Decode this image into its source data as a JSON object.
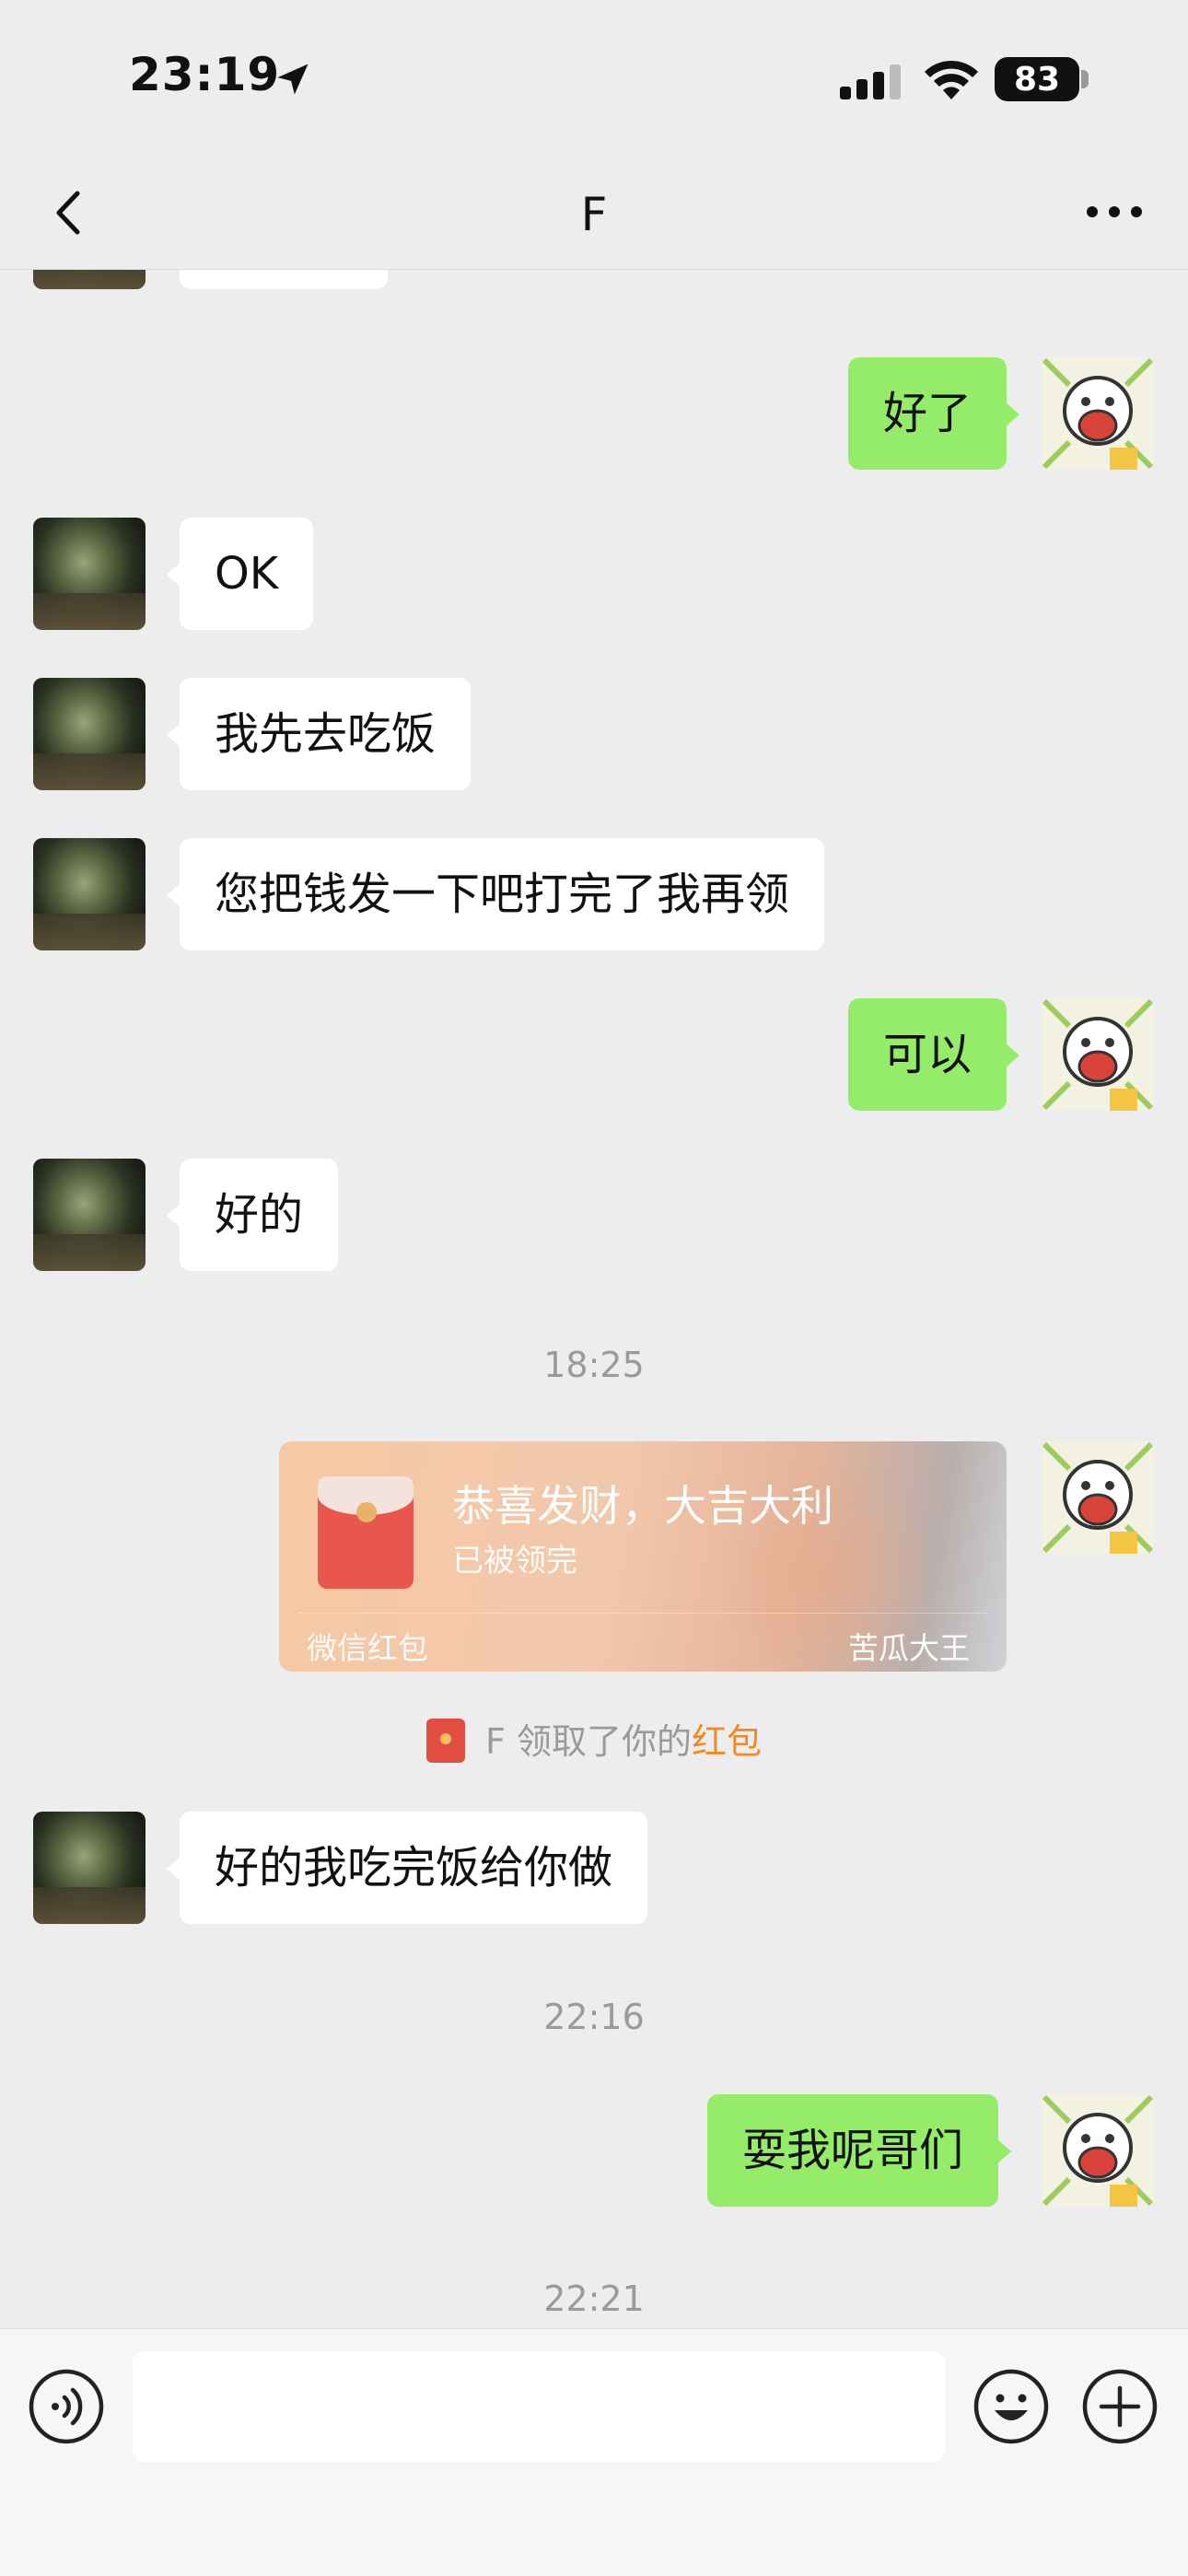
{
  "status_bar": {
    "time": "23:19",
    "battery": "83"
  },
  "nav": {
    "title": "F"
  },
  "messages": [
    {
      "side": "right",
      "text": "好了"
    },
    {
      "side": "left",
      "text": "OK"
    },
    {
      "side": "left",
      "text": "我先去吃饭"
    },
    {
      "side": "left",
      "text": "您把钱发一下吧打完了我再领"
    },
    {
      "side": "right",
      "text": "可以"
    },
    {
      "side": "left",
      "text": "好的"
    },
    {
      "side": "left",
      "text": "好的我吃完饭给你做"
    },
    {
      "side": "right",
      "text": "耍我呢哥们"
    }
  ],
  "timestamps": [
    "18:25",
    "22:16",
    "22:21"
  ],
  "red_packet": {
    "title": "恭喜发财，大吉大利",
    "status": "已被领完",
    "label": "微信红包",
    "cover_name": "苦瓜大王"
  },
  "system_notice": {
    "prefix": "F 领取了你的",
    "link": "红包"
  },
  "input": {
    "placeholder": ""
  }
}
